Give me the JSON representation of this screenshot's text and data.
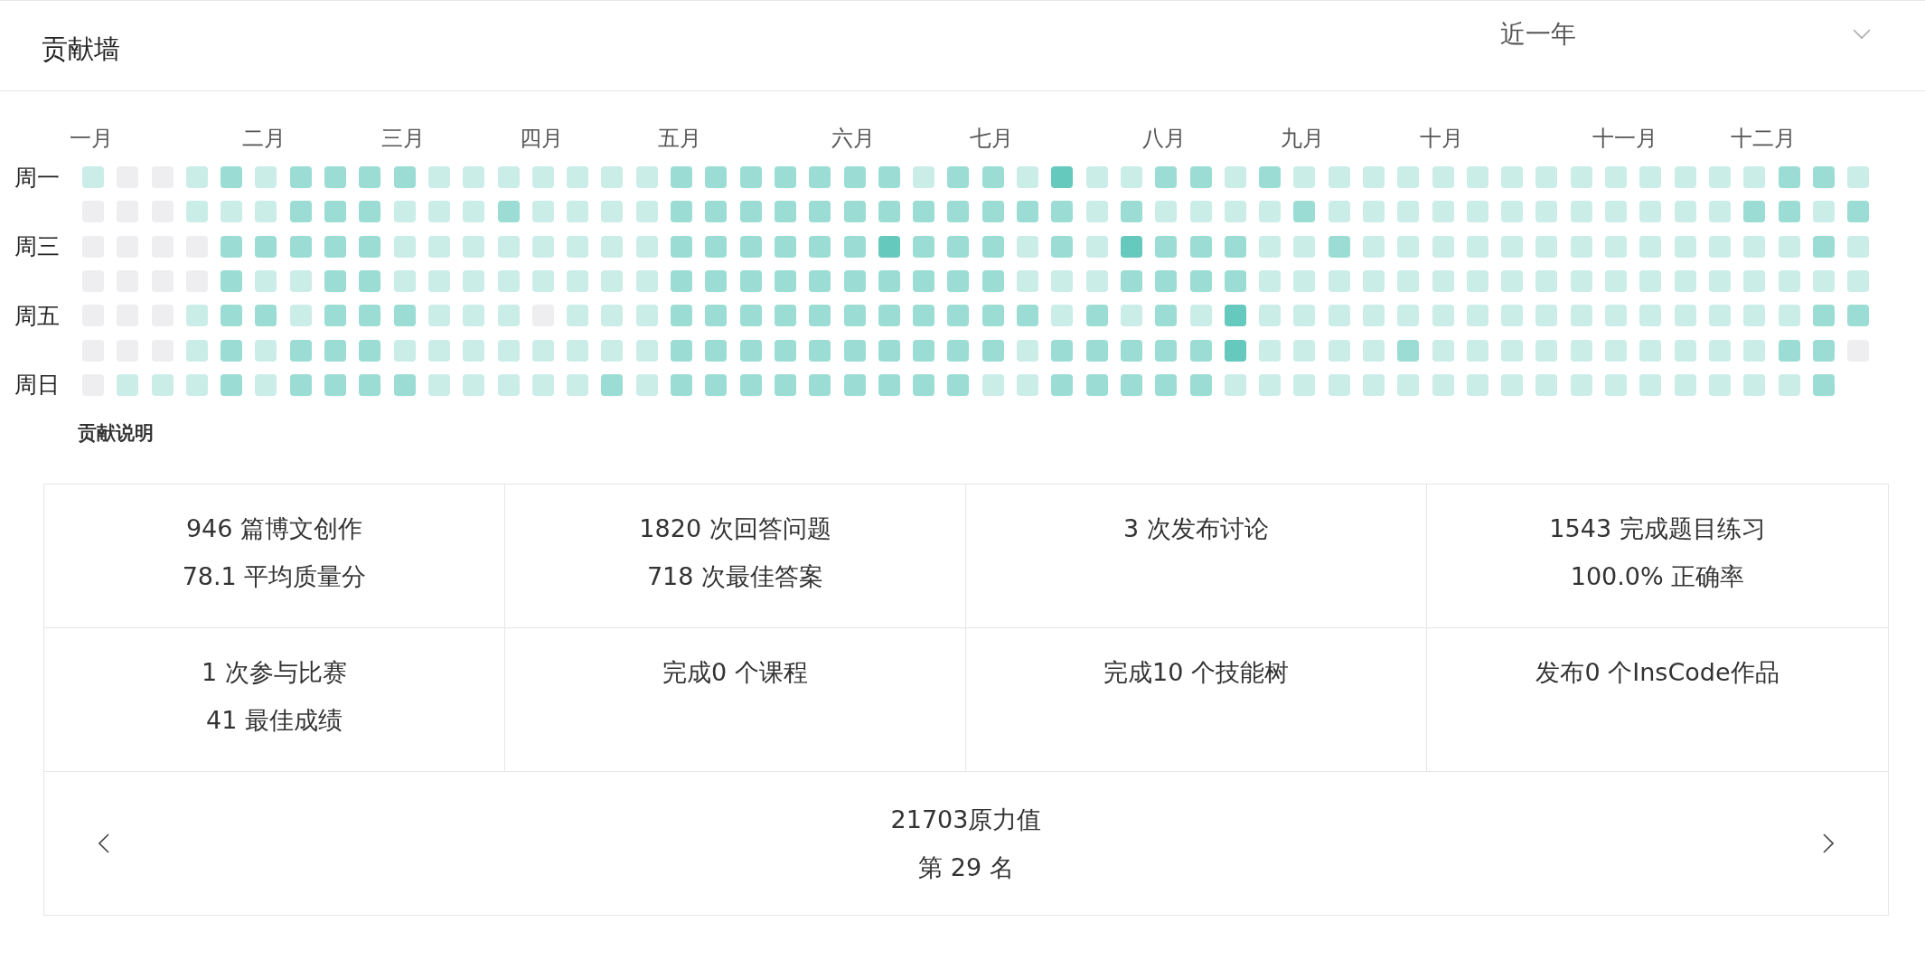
{
  "header": {
    "title": "贡献墙",
    "range": "近一年"
  },
  "months": [
    "一月",
    "二月",
    "三月",
    "四月",
    "五月",
    "六月",
    "七月",
    "八月",
    "九月",
    "十月",
    "十一月",
    "十二月"
  ],
  "rows": [
    {
      "label": "周一",
      "cells": [
        {
          "color": "#cbede8"
        },
        {
          "color": "#eeeef0"
        },
        {
          "color": "#eeeef0"
        },
        {
          "color": "#cbede8"
        },
        {
          "color": "#9bddd4"
        },
        {
          "color": "#cbede8"
        },
        {
          "color": "#9bddd4"
        },
        {
          "color": "#9bddd4"
        },
        {
          "color": "#9bddd4"
        },
        {
          "color": "#9bddd4"
        },
        {
          "color": "#cbede8"
        },
        {
          "color": "#cbede8"
        },
        {
          "color": "#cbede8"
        },
        {
          "color": "#cbede8"
        },
        {
          "color": "#cbede8"
        },
        {
          "color": "#cbede8"
        },
        {
          "color": "#cbede8"
        },
        {
          "color": "#9bddd4"
        },
        {
          "color": "#9bddd4"
        },
        {
          "color": "#9bddd4"
        },
        {
          "color": "#9bddd4"
        },
        {
          "color": "#9bddd4"
        },
        {
          "color": "#9bddd4"
        },
        {
          "color": "#9bddd4"
        },
        {
          "color": "#cbede8"
        },
        {
          "color": "#9bddd4"
        },
        {
          "color": "#9bddd4"
        },
        {
          "color": "#cbede8"
        },
        {
          "color": "#66c9bd"
        },
        {
          "color": "#cbede8"
        },
        {
          "color": "#cbede8"
        },
        {
          "color": "#9bddd4"
        },
        {
          "color": "#9bddd4"
        },
        {
          "color": "#cbede8"
        },
        {
          "color": "#9bddd4"
        },
        {
          "color": "#cbede8"
        },
        {
          "color": "#cbede8"
        },
        {
          "color": "#cbede8"
        },
        {
          "color": "#cbede8"
        },
        {
          "color": "#cbede8"
        },
        {
          "color": "#cbede8"
        },
        {
          "color": "#cbede8"
        },
        {
          "color": "#cbede8"
        },
        {
          "color": "#cbede8"
        },
        {
          "color": "#cbede8"
        },
        {
          "color": "#cbede8"
        },
        {
          "color": "#cbede8"
        },
        {
          "color": "#cbede8"
        },
        {
          "color": "#cbede8"
        },
        {
          "color": "#9bddd4"
        },
        {
          "color": "#9bddd4"
        },
        {
          "color": "#cbede8"
        }
      ]
    },
    {
      "cells": [
        {
          "color": "#eeeef0"
        },
        {
          "color": "#eeeef0"
        },
        {
          "color": "#eeeef0"
        },
        {
          "color": "#cbede8"
        },
        {
          "color": "#cbede8"
        },
        {
          "color": "#cbede8"
        },
        {
          "color": "#9bddd4"
        },
        {
          "color": "#9bddd4"
        },
        {
          "color": "#9bddd4"
        },
        {
          "color": "#cbede8"
        },
        {
          "color": "#cbede8"
        },
        {
          "color": "#cbede8"
        },
        {
          "color": "#9bddd4"
        },
        {
          "color": "#cbede8"
        },
        {
          "color": "#cbede8"
        },
        {
          "color": "#cbede8"
        },
        {
          "color": "#cbede8"
        },
        {
          "color": "#9bddd4"
        },
        {
          "color": "#9bddd4"
        },
        {
          "color": "#9bddd4"
        },
        {
          "color": "#9bddd4"
        },
        {
          "color": "#9bddd4"
        },
        {
          "color": "#9bddd4"
        },
        {
          "color": "#9bddd4"
        },
        {
          "color": "#9bddd4"
        },
        {
          "color": "#9bddd4"
        },
        {
          "color": "#9bddd4"
        },
        {
          "color": "#9bddd4"
        },
        {
          "color": "#9bddd4"
        },
        {
          "color": "#cbede8"
        },
        {
          "color": "#9bddd4"
        },
        {
          "color": "#cbede8"
        },
        {
          "color": "#cbede8"
        },
        {
          "color": "#cbede8"
        },
        {
          "color": "#cbede8"
        },
        {
          "color": "#9bddd4"
        },
        {
          "color": "#cbede8"
        },
        {
          "color": "#cbede8"
        },
        {
          "color": "#cbede8"
        },
        {
          "color": "#cbede8"
        },
        {
          "color": "#cbede8"
        },
        {
          "color": "#cbede8"
        },
        {
          "color": "#cbede8"
        },
        {
          "color": "#cbede8"
        },
        {
          "color": "#cbede8"
        },
        {
          "color": "#cbede8"
        },
        {
          "color": "#cbede8"
        },
        {
          "color": "#cbede8"
        },
        {
          "color": "#9bddd4"
        },
        {
          "color": "#9bddd4"
        },
        {
          "color": "#cbede8"
        },
        {
          "color": "#9bddd4"
        }
      ]
    },
    {
      "label": "周三",
      "cells": [
        {
          "color": "#eeeef0"
        },
        {
          "color": "#eeeef0"
        },
        {
          "color": "#eeeef0"
        },
        {
          "color": "#eeeef0"
        },
        {
          "color": "#9bddd4"
        },
        {
          "color": "#9bddd4"
        },
        {
          "color": "#9bddd4"
        },
        {
          "color": "#9bddd4"
        },
        {
          "color": "#9bddd4"
        },
        {
          "color": "#cbede8"
        },
        {
          "color": "#cbede8"
        },
        {
          "color": "#cbede8"
        },
        {
          "color": "#cbede8"
        },
        {
          "color": "#cbede8"
        },
        {
          "color": "#cbede8"
        },
        {
          "color": "#cbede8"
        },
        {
          "color": "#cbede8"
        },
        {
          "color": "#9bddd4"
        },
        {
          "color": "#9bddd4"
        },
        {
          "color": "#9bddd4"
        },
        {
          "color": "#9bddd4"
        },
        {
          "color": "#9bddd4"
        },
        {
          "color": "#9bddd4"
        },
        {
          "color": "#66c9bd"
        },
        {
          "color": "#9bddd4"
        },
        {
          "color": "#9bddd4"
        },
        {
          "color": "#9bddd4"
        },
        {
          "color": "#cbede8"
        },
        {
          "color": "#9bddd4"
        },
        {
          "color": "#cbede8"
        },
        {
          "color": "#66c9bd"
        },
        {
          "color": "#9bddd4"
        },
        {
          "color": "#9bddd4"
        },
        {
          "color": "#9bddd4"
        },
        {
          "color": "#cbede8"
        },
        {
          "color": "#cbede8"
        },
        {
          "color": "#9bddd4"
        },
        {
          "color": "#cbede8"
        },
        {
          "color": "#cbede8"
        },
        {
          "color": "#cbede8"
        },
        {
          "color": "#cbede8"
        },
        {
          "color": "#cbede8"
        },
        {
          "color": "#cbede8"
        },
        {
          "color": "#cbede8"
        },
        {
          "color": "#cbede8"
        },
        {
          "color": "#cbede8"
        },
        {
          "color": "#cbede8"
        },
        {
          "color": "#cbede8"
        },
        {
          "color": "#cbede8"
        },
        {
          "color": "#cbede8"
        },
        {
          "color": "#9bddd4"
        },
        {
          "color": "#cbede8"
        }
      ]
    },
    {
      "cells": [
        {
          "color": "#eeeef0"
        },
        {
          "color": "#eeeef0"
        },
        {
          "color": "#eeeef0"
        },
        {
          "color": "#eeeef0"
        },
        {
          "color": "#9bddd4"
        },
        {
          "color": "#cbede8"
        },
        {
          "color": "#cbede8"
        },
        {
          "color": "#9bddd4"
        },
        {
          "color": "#9bddd4"
        },
        {
          "color": "#cbede8"
        },
        {
          "color": "#cbede8"
        },
        {
          "color": "#cbede8"
        },
        {
          "color": "#cbede8"
        },
        {
          "color": "#cbede8"
        },
        {
          "color": "#cbede8"
        },
        {
          "color": "#cbede8"
        },
        {
          "color": "#cbede8"
        },
        {
          "color": "#9bddd4"
        },
        {
          "color": "#9bddd4"
        },
        {
          "color": "#9bddd4"
        },
        {
          "color": "#9bddd4"
        },
        {
          "color": "#9bddd4"
        },
        {
          "color": "#9bddd4"
        },
        {
          "color": "#9bddd4"
        },
        {
          "color": "#9bddd4"
        },
        {
          "color": "#9bddd4"
        },
        {
          "color": "#9bddd4"
        },
        {
          "color": "#cbede8"
        },
        {
          "color": "#cbede8"
        },
        {
          "color": "#cbede8"
        },
        {
          "color": "#9bddd4"
        },
        {
          "color": "#9bddd4"
        },
        {
          "color": "#9bddd4"
        },
        {
          "color": "#9bddd4"
        },
        {
          "color": "#cbede8"
        },
        {
          "color": "#cbede8"
        },
        {
          "color": "#cbede8"
        },
        {
          "color": "#cbede8"
        },
        {
          "color": "#cbede8"
        },
        {
          "color": "#cbede8"
        },
        {
          "color": "#cbede8"
        },
        {
          "color": "#cbede8"
        },
        {
          "color": "#cbede8"
        },
        {
          "color": "#cbede8"
        },
        {
          "color": "#cbede8"
        },
        {
          "color": "#cbede8"
        },
        {
          "color": "#cbede8"
        },
        {
          "color": "#cbede8"
        },
        {
          "color": "#cbede8"
        },
        {
          "color": "#cbede8"
        },
        {
          "color": "#cbede8"
        },
        {
          "color": "#cbede8"
        }
      ]
    },
    {
      "label": "周五",
      "cells": [
        {
          "color": "#eeeef0"
        },
        {
          "color": "#eeeef0"
        },
        {
          "color": "#eeeef0"
        },
        {
          "color": "#cbede8"
        },
        {
          "color": "#9bddd4"
        },
        {
          "color": "#9bddd4"
        },
        {
          "color": "#cbede8"
        },
        {
          "color": "#9bddd4"
        },
        {
          "color": "#9bddd4"
        },
        {
          "color": "#9bddd4"
        },
        {
          "color": "#cbede8"
        },
        {
          "color": "#cbede8"
        },
        {
          "color": "#cbede8"
        },
        {
          "color": "#eeeef0"
        },
        {
          "color": "#cbede8"
        },
        {
          "color": "#cbede8"
        },
        {
          "color": "#cbede8"
        },
        {
          "color": "#9bddd4"
        },
        {
          "color": "#9bddd4"
        },
        {
          "color": "#9bddd4"
        },
        {
          "color": "#9bddd4"
        },
        {
          "color": "#9bddd4"
        },
        {
          "color": "#9bddd4"
        },
        {
          "color": "#9bddd4"
        },
        {
          "color": "#9bddd4"
        },
        {
          "color": "#9bddd4"
        },
        {
          "color": "#9bddd4"
        },
        {
          "color": "#9bddd4"
        },
        {
          "color": "#cbede8"
        },
        {
          "color": "#9bddd4"
        },
        {
          "color": "#cbede8"
        },
        {
          "color": "#9bddd4"
        },
        {
          "color": "#cbede8"
        },
        {
          "color": "#66c9bd"
        },
        {
          "color": "#cbede8"
        },
        {
          "color": "#cbede8"
        },
        {
          "color": "#cbede8"
        },
        {
          "color": "#cbede8"
        },
        {
          "color": "#cbede8"
        },
        {
          "color": "#cbede8"
        },
        {
          "color": "#cbede8"
        },
        {
          "color": "#cbede8"
        },
        {
          "color": "#cbede8"
        },
        {
          "color": "#cbede8"
        },
        {
          "color": "#cbede8"
        },
        {
          "color": "#cbede8"
        },
        {
          "color": "#cbede8"
        },
        {
          "color": "#cbede8"
        },
        {
          "color": "#cbede8"
        },
        {
          "color": "#cbede8"
        },
        {
          "color": "#9bddd4"
        },
        {
          "color": "#9bddd4"
        }
      ]
    },
    {
      "cells": [
        {
          "color": "#eeeef0"
        },
        {
          "color": "#eeeef0"
        },
        {
          "color": "#eeeef0"
        },
        {
          "color": "#cbede8"
        },
        {
          "color": "#9bddd4"
        },
        {
          "color": "#cbede8"
        },
        {
          "color": "#9bddd4"
        },
        {
          "color": "#9bddd4"
        },
        {
          "color": "#9bddd4"
        },
        {
          "color": "#cbede8"
        },
        {
          "color": "#cbede8"
        },
        {
          "color": "#cbede8"
        },
        {
          "color": "#cbede8"
        },
        {
          "color": "#cbede8"
        },
        {
          "color": "#cbede8"
        },
        {
          "color": "#cbede8"
        },
        {
          "color": "#cbede8"
        },
        {
          "color": "#9bddd4"
        },
        {
          "color": "#9bddd4"
        },
        {
          "color": "#9bddd4"
        },
        {
          "color": "#9bddd4"
        },
        {
          "color": "#9bddd4"
        },
        {
          "color": "#9bddd4"
        },
        {
          "color": "#9bddd4"
        },
        {
          "color": "#9bddd4"
        },
        {
          "color": "#9bddd4"
        },
        {
          "color": "#9bddd4"
        },
        {
          "color": "#cbede8"
        },
        {
          "color": "#9bddd4"
        },
        {
          "color": "#9bddd4"
        },
        {
          "color": "#9bddd4"
        },
        {
          "color": "#9bddd4"
        },
        {
          "color": "#9bddd4"
        },
        {
          "color": "#66c9bd"
        },
        {
          "color": "#cbede8"
        },
        {
          "color": "#cbede8"
        },
        {
          "color": "#cbede8"
        },
        {
          "color": "#cbede8"
        },
        {
          "color": "#9bddd4"
        },
        {
          "color": "#cbede8"
        },
        {
          "color": "#cbede8"
        },
        {
          "color": "#cbede8"
        },
        {
          "color": "#cbede8"
        },
        {
          "color": "#cbede8"
        },
        {
          "color": "#cbede8"
        },
        {
          "color": "#cbede8"
        },
        {
          "color": "#cbede8"
        },
        {
          "color": "#cbede8"
        },
        {
          "color": "#cbede8"
        },
        {
          "color": "#9bddd4"
        },
        {
          "color": "#9bddd4"
        },
        {
          "color": "#eeeef0"
        }
      ]
    },
    {
      "label": "周日",
      "cells": [
        {
          "color": "#eeeef0"
        },
        {
          "color": "#cbede8"
        },
        {
          "color": "#cbede8"
        },
        {
          "color": "#cbede8"
        },
        {
          "color": "#9bddd4"
        },
        {
          "color": "#cbede8"
        },
        {
          "color": "#9bddd4"
        },
        {
          "color": "#9bddd4"
        },
        {
          "color": "#9bddd4"
        },
        {
          "color": "#9bddd4"
        },
        {
          "color": "#cbede8"
        },
        {
          "color": "#cbede8"
        },
        {
          "color": "#cbede8"
        },
        {
          "color": "#cbede8"
        },
        {
          "color": "#cbede8"
        },
        {
          "color": "#9bddd4"
        },
        {
          "color": "#cbede8"
        },
        {
          "color": "#9bddd4"
        },
        {
          "color": "#9bddd4"
        },
        {
          "color": "#9bddd4"
        },
        {
          "color": "#9bddd4"
        },
        {
          "color": "#9bddd4"
        },
        {
          "color": "#9bddd4"
        },
        {
          "color": "#9bddd4"
        },
        {
          "color": "#9bddd4"
        },
        {
          "color": "#9bddd4"
        },
        {
          "color": "#cbede8"
        },
        {
          "color": "#cbede8"
        },
        {
          "color": "#9bddd4"
        },
        {
          "color": "#9bddd4"
        },
        {
          "color": "#9bddd4"
        },
        {
          "color": "#9bddd4"
        },
        {
          "color": "#9bddd4"
        },
        {
          "color": "#cbede8"
        },
        {
          "color": "#cbede8"
        },
        {
          "color": "#cbede8"
        },
        {
          "color": "#cbede8"
        },
        {
          "color": "#cbede8"
        },
        {
          "color": "#cbede8"
        },
        {
          "color": "#cbede8"
        },
        {
          "color": "#cbede8"
        },
        {
          "color": "#cbede8"
        },
        {
          "color": "#cbede8"
        },
        {
          "color": "#cbede8"
        },
        {
          "color": "#cbede8"
        },
        {
          "color": "#cbede8"
        },
        {
          "color": "#cbede8"
        },
        {
          "color": "#cbede8"
        },
        {
          "color": "#cbede8"
        },
        {
          "color": "#cbede8"
        },
        {
          "color": "#9bddd4"
        }
      ]
    }
  ],
  "legend_link": "贡献说明",
  "stats": [
    {
      "lines": [
        "946 篇博文创作",
        "78.1 平均质量分"
      ]
    },
    {
      "lines": [
        "1820 次回答问题",
        "718 次最佳答案"
      ]
    },
    {
      "lines": [
        "3 次发布讨论"
      ]
    },
    {
      "lines": [
        "1543 完成题目练习",
        "100.0% 正确率"
      ]
    },
    {
      "lines": [
        "1 次参与比赛",
        "41 最佳成绩"
      ]
    },
    {
      "lines": [
        "完成0 个课程"
      ]
    },
    {
      "lines": [
        "完成10 个技能树"
      ]
    },
    {
      "lines": [
        "发布0 个InsCode作品"
      ]
    }
  ],
  "rank": {
    "lines": [
      "21703原力值",
      "第 29 名"
    ]
  }
}
